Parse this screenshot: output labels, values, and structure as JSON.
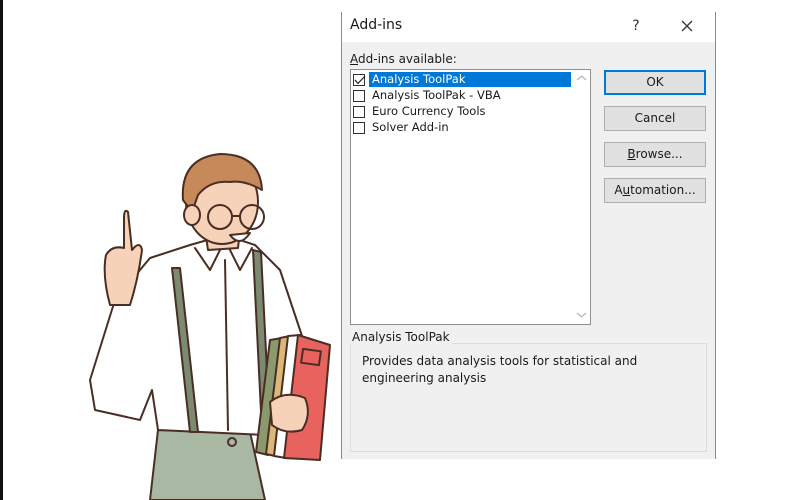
{
  "dialog": {
    "title": "Add-ins",
    "help_label": "?",
    "available_label_prefix": "A",
    "available_label_rest": "dd-ins available:",
    "addins": [
      {
        "label": "Analysis ToolPak",
        "checked": true,
        "selected": true
      },
      {
        "label": "Analysis ToolPak - VBA",
        "checked": false,
        "selected": false
      },
      {
        "label": "Euro Currency Tools",
        "checked": false,
        "selected": false
      },
      {
        "label": "Solver Add-in",
        "checked": false,
        "selected": false
      }
    ],
    "buttons": {
      "ok": "OK",
      "cancel": "Cancel",
      "browse_pre": "",
      "browse_u": "B",
      "browse_post": "rowse...",
      "automation_pre": "A",
      "automation_u": "u",
      "automation_post": "tomation..."
    },
    "description_group": {
      "title": "Analysis ToolPak",
      "text": "Provides data analysis tools for statistical and engineering analysis"
    },
    "colors": {
      "selection": "#0078d7",
      "dialog_bg": "#f0f0f0"
    }
  },
  "illustration": {
    "subject": "man-with-glasses-pointing-up-holding-folders"
  }
}
